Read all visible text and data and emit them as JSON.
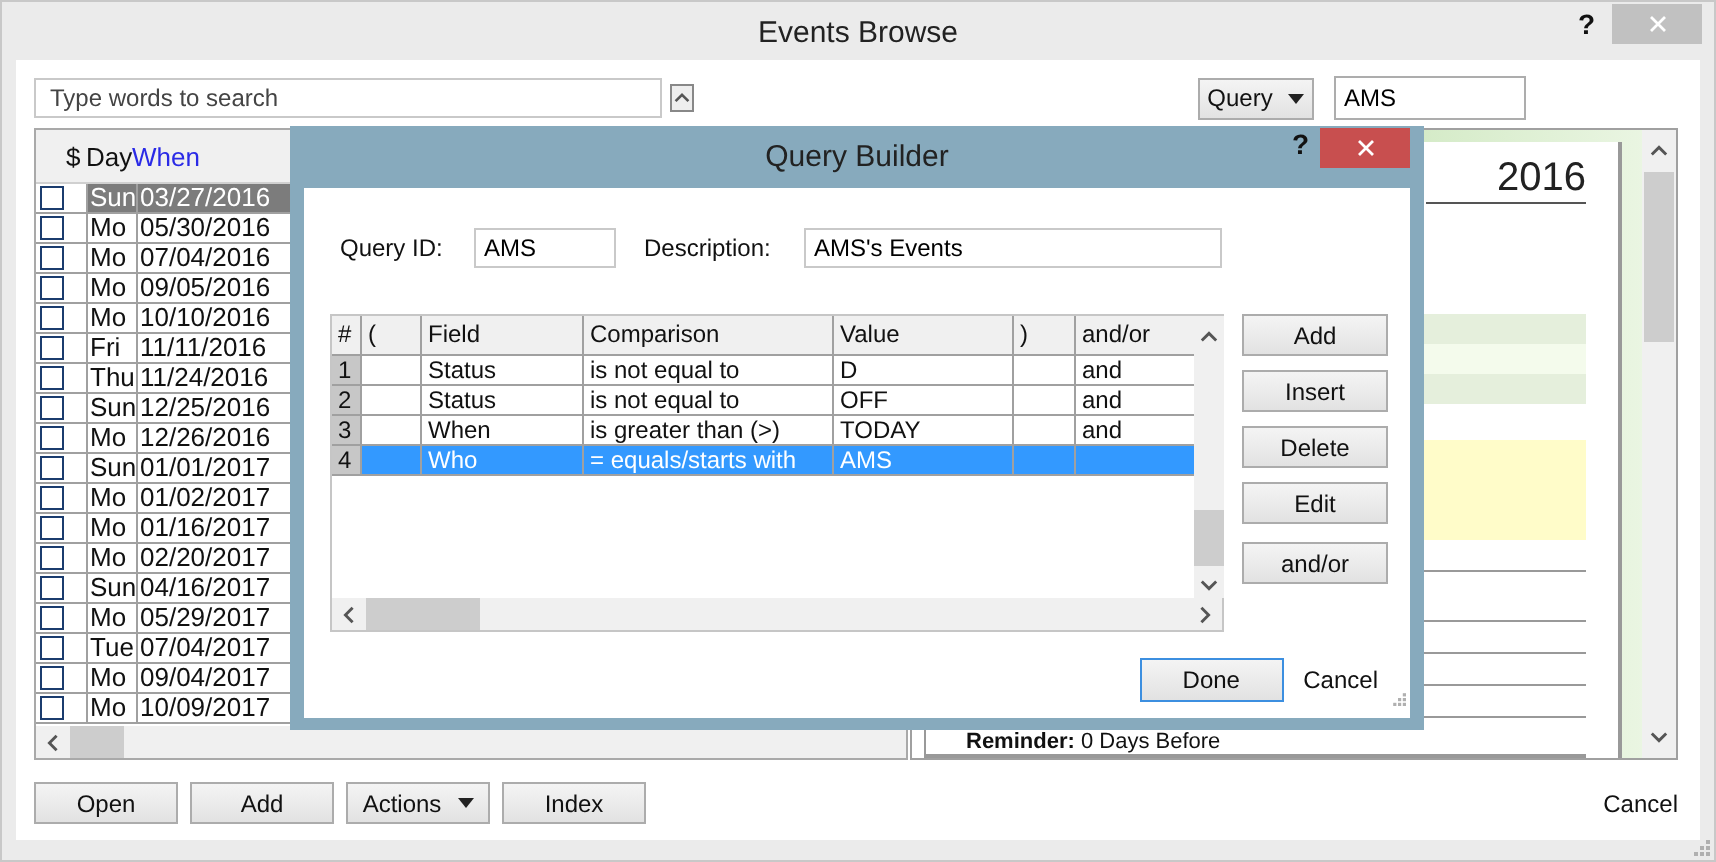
{
  "window": {
    "title": "Events Browse",
    "help": "?"
  },
  "search": {
    "placeholder": "Type words to search"
  },
  "query": {
    "button": "Query",
    "value": "AMS"
  },
  "events": {
    "columns": [
      {
        "label": "$",
        "sorted": false
      },
      {
        "label": "Day",
        "sorted": false
      },
      {
        "label": "When",
        "sorted": true
      }
    ],
    "rows": [
      {
        "day": "Sun",
        "date": "03/27/2016",
        "checked": false,
        "selected": true
      },
      {
        "day": "Mo",
        "date": "05/30/2016",
        "checked": false,
        "selected": false
      },
      {
        "day": "Mo",
        "date": "07/04/2016",
        "checked": false,
        "selected": false
      },
      {
        "day": "Mo",
        "date": "09/05/2016",
        "checked": false,
        "selected": false
      },
      {
        "day": "Mo",
        "date": "10/10/2016",
        "checked": false,
        "selected": false
      },
      {
        "day": "Fri",
        "date": "11/11/2016",
        "checked": false,
        "selected": false
      },
      {
        "day": "Thu",
        "date": "11/24/2016",
        "checked": false,
        "selected": false
      },
      {
        "day": "Sun",
        "date": "12/25/2016",
        "checked": false,
        "selected": false
      },
      {
        "day": "Mo",
        "date": "12/26/2016",
        "checked": false,
        "selected": false
      },
      {
        "day": "Sun",
        "date": "01/01/2017",
        "checked": false,
        "selected": false
      },
      {
        "day": "Mo",
        "date": "01/02/2017",
        "checked": false,
        "selected": false
      },
      {
        "day": "Mo",
        "date": "01/16/2017",
        "checked": false,
        "selected": false
      },
      {
        "day": "Mo",
        "date": "02/20/2017",
        "checked": false,
        "selected": false
      },
      {
        "day": "Sun",
        "date": "04/16/2017",
        "checked": false,
        "selected": false
      },
      {
        "day": "Mo",
        "date": "05/29/2017",
        "checked": false,
        "selected": false
      },
      {
        "day": "Tue",
        "date": "07/04/2017",
        "checked": false,
        "selected": false
      },
      {
        "day": "Mo",
        "date": "09/04/2017",
        "checked": false,
        "selected": false
      },
      {
        "day": "Mo",
        "date": "10/09/2017",
        "checked": false,
        "selected": false
      }
    ]
  },
  "preview": {
    "year": "2016",
    "reminder": "**Reminder:** 0 Days Before"
  },
  "buttons": [
    {
      "label": "Open",
      "kind": "button"
    },
    {
      "label": "Add",
      "kind": "button"
    },
    {
      "label": "Actions",
      "kind": "menu"
    },
    {
      "label": "Index",
      "kind": "button"
    }
  ],
  "cancel": "Cancel",
  "dialog": {
    "title": "Query Builder",
    "help": "?",
    "query_id_label": "Query ID:",
    "query_id": "AMS",
    "description_label": "Description:",
    "description": "AMS's Events",
    "grid": {
      "columns": [
        "#",
        "(",
        "Field",
        "Comparison",
        "Value",
        ")",
        "and/or"
      ],
      "rows": [
        {
          "number": "1",
          "open": "",
          "field": "Status",
          "comparison": "is not equal to",
          "value": "D",
          "close": "",
          "andor": "and",
          "selected": false
        },
        {
          "number": "2",
          "open": "",
          "field": "Status",
          "comparison": "is not equal to",
          "value": "OFF",
          "close": "",
          "andor": "and",
          "selected": false
        },
        {
          "number": "3",
          "open": "",
          "field": "When",
          "comparison": "is greater than (>)",
          "value": "TODAY",
          "close": "",
          "andor": "and",
          "selected": false
        },
        {
          "number": "4",
          "open": "",
          "field": "Who",
          "comparison": "= equals/starts with",
          "value": "AMS",
          "close": "",
          "andor": "",
          "selected": true
        }
      ]
    },
    "side_buttons": [
      "Add",
      "Insert",
      "Delete",
      "Edit",
      "and/or"
    ],
    "done": "Done",
    "cancel": "Cancel"
  }
}
